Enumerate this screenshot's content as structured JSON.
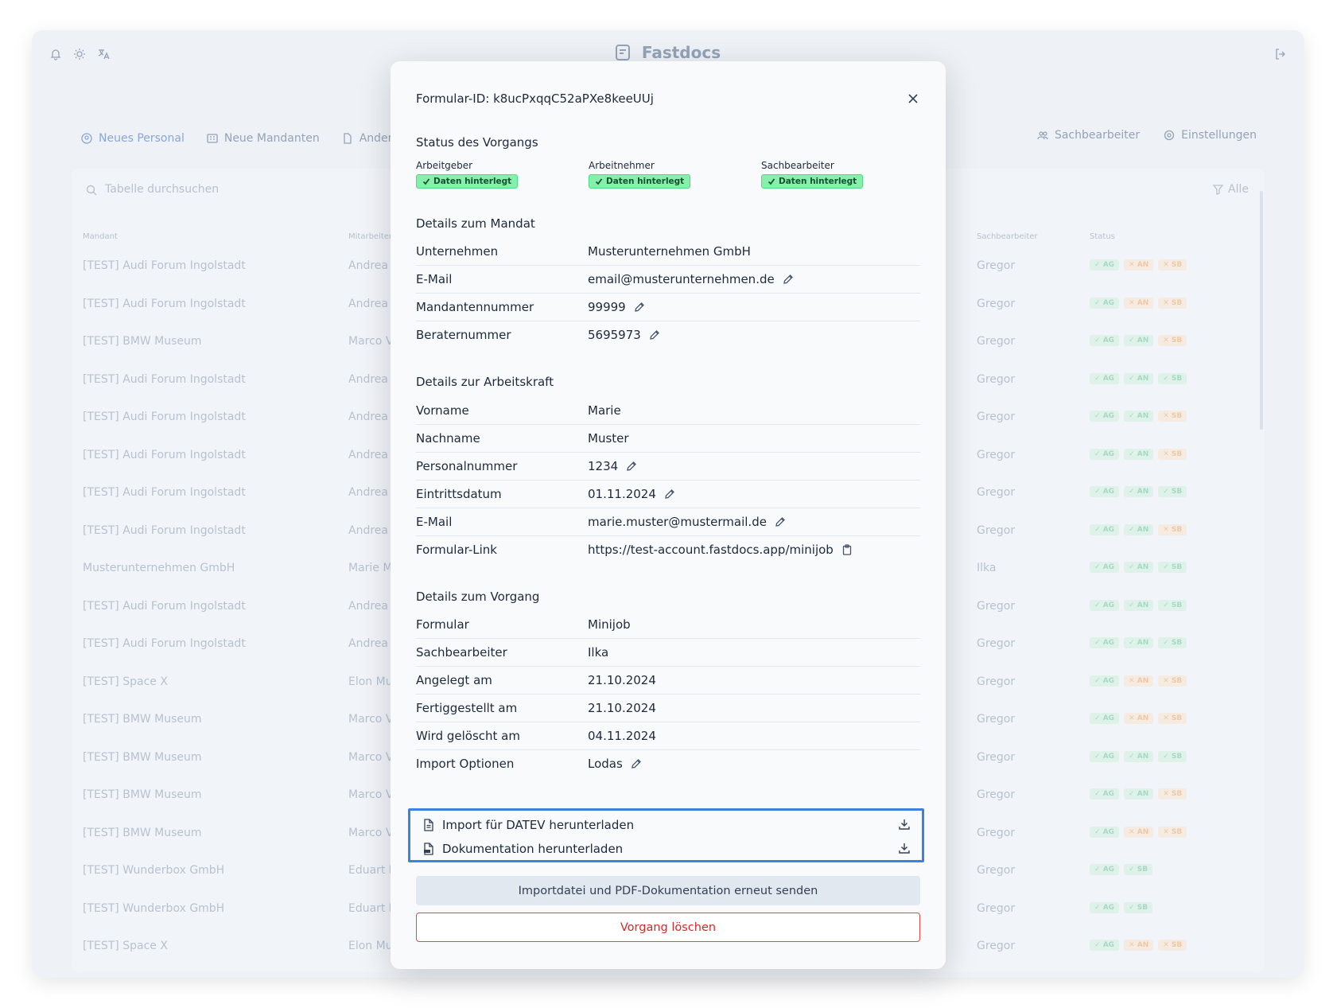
{
  "app": {
    "brand": "Fastdocs",
    "tabs": [
      "Neues Personal",
      "Neue Mandanten",
      "Ander"
    ],
    "tabs_right": [
      "Sachbearbeiter",
      "Einstellungen"
    ],
    "search_placeholder": "Tabelle durchsuchen",
    "filter_label": "Alle",
    "columns": [
      "Mandant",
      "Mitarbeiter",
      "Sachbearbeiter",
      "Status"
    ],
    "rows": [
      {
        "mandant": "[TEST] Audi Forum Ingolstadt",
        "mitarbeiter": "Andrea",
        "sb": "Gregor",
        "status": [
          "ok",
          "no",
          "no"
        ]
      },
      {
        "mandant": "[TEST] Audi Forum Ingolstadt",
        "mitarbeiter": "Andrea",
        "sb": "Gregor",
        "status": [
          "ok",
          "no",
          "no"
        ]
      },
      {
        "mandant": "[TEST] BMW Museum",
        "mitarbeiter": "Marco V",
        "sb": "Gregor",
        "status": [
          "ok",
          "ok",
          "no"
        ]
      },
      {
        "mandant": "[TEST] Audi Forum Ingolstadt",
        "mitarbeiter": "Andrea",
        "sb": "Gregor",
        "status": [
          "ok",
          "ok",
          "ok"
        ]
      },
      {
        "mandant": "[TEST] Audi Forum Ingolstadt",
        "mitarbeiter": "Andrea",
        "sb": "Gregor",
        "status": [
          "ok",
          "ok",
          "no"
        ]
      },
      {
        "mandant": "[TEST] Audi Forum Ingolstadt",
        "mitarbeiter": "Andrea",
        "sb": "Gregor",
        "status": [
          "ok",
          "ok",
          "no"
        ]
      },
      {
        "mandant": "[TEST] Audi Forum Ingolstadt",
        "mitarbeiter": "Andrea",
        "sb": "Gregor",
        "status": [
          "ok",
          "ok",
          "ok"
        ]
      },
      {
        "mandant": "[TEST] Audi Forum Ingolstadt",
        "mitarbeiter": "Andrea",
        "sb": "Gregor",
        "status": [
          "ok",
          "ok",
          "no"
        ]
      },
      {
        "mandant": "Musterunternehmen GmbH",
        "mitarbeiter": "Marie M",
        "sb": "Ilka",
        "status": [
          "ok",
          "ok",
          "ok"
        ]
      },
      {
        "mandant": "[TEST] Audi Forum Ingolstadt",
        "mitarbeiter": "Andrea",
        "sb": "Gregor",
        "status": [
          "ok",
          "ok",
          "ok"
        ]
      },
      {
        "mandant": "[TEST] Audi Forum Ingolstadt",
        "mitarbeiter": "Andrea",
        "sb": "Gregor",
        "status": [
          "ok",
          "ok",
          "ok"
        ]
      },
      {
        "mandant": "[TEST] Space X",
        "mitarbeiter": "Elon Mu",
        "sb": "Gregor",
        "status": [
          "ok",
          "no",
          "no"
        ]
      },
      {
        "mandant": "[TEST] BMW Museum",
        "mitarbeiter": "Marco V",
        "sb": "Gregor",
        "status": [
          "ok",
          "no",
          "no"
        ]
      },
      {
        "mandant": "[TEST] BMW Museum",
        "mitarbeiter": "Marco V",
        "sb": "Gregor",
        "status": [
          "ok",
          "ok",
          "ok"
        ]
      },
      {
        "mandant": "[TEST] BMW Museum",
        "mitarbeiter": "Marco V",
        "sb": "Gregor",
        "status": [
          "ok",
          "ok",
          "no"
        ]
      },
      {
        "mandant": "[TEST] BMW Museum",
        "mitarbeiter": "Marco V",
        "sb": "Gregor",
        "status": [
          "ok",
          "no",
          "no"
        ]
      },
      {
        "mandant": "[TEST] Wunderbox GmbH",
        "mitarbeiter": "Eduart F",
        "sb": "Gregor",
        "status": [
          "ok",
          "ok"
        ]
      },
      {
        "mandant": "[TEST] Wunderbox GmbH",
        "mitarbeiter": "Eduart F",
        "sb": "Gregor",
        "status": [
          "ok",
          "ok"
        ]
      },
      {
        "mandant": "[TEST] Space X",
        "mitarbeiter": "Elon Mu",
        "sb": "Gregor",
        "status": [
          "ok",
          "no",
          "no"
        ]
      }
    ],
    "badge_labels": [
      "AG",
      "AN",
      "SB"
    ],
    "badge_labels_short": [
      "AG",
      "SB"
    ]
  },
  "modal": {
    "title": "Formular-ID: k8ucPxqqC52aPXe8keeUUj",
    "status": {
      "heading": "Status des Vorgangs",
      "items": [
        {
          "label": "Arbeitgeber",
          "value": "Daten hinterlegt"
        },
        {
          "label": "Arbeitnehmer",
          "value": "Daten hinterlegt"
        },
        {
          "label": "Sachbearbeiter",
          "value": "Daten hinterlegt"
        }
      ]
    },
    "mandat": {
      "heading": "Details zum Mandat",
      "rows": [
        {
          "label": "Unternehmen",
          "value": "Musterunternehmen GmbH",
          "icon": ""
        },
        {
          "label": "E-Mail",
          "value": "email@musterunternehmen.de",
          "icon": "pencil-icon"
        },
        {
          "label": "Mandantennummer",
          "value": "99999",
          "icon": "pencil-icon"
        },
        {
          "label": "Beraternummer",
          "value": "5695973",
          "icon": "pencil-icon"
        }
      ]
    },
    "arbeitskraft": {
      "heading": "Details zur Arbeitskraft",
      "rows": [
        {
          "label": "Vorname",
          "value": "Marie",
          "icon": ""
        },
        {
          "label": "Nachname",
          "value": "Muster",
          "icon": ""
        },
        {
          "label": "Personalnummer",
          "value": "1234",
          "icon": "pencil-icon"
        },
        {
          "label": "Eintrittsdatum",
          "value": "01.11.2024",
          "icon": "pencil-icon"
        },
        {
          "label": "E-Mail",
          "value": "marie.muster@mustermail.de",
          "icon": "pencil-icon"
        },
        {
          "label": "Formular-Link",
          "value": "https://test-account.fastdocs.app/minijob",
          "icon": "clipboard-icon"
        }
      ]
    },
    "vorgang": {
      "heading": "Details zum Vorgang",
      "rows": [
        {
          "label": "Formular",
          "value": "Minijob",
          "icon": ""
        },
        {
          "label": "Sachbearbeiter",
          "value": "Ilka",
          "icon": ""
        },
        {
          "label": "Angelegt am",
          "value": "21.10.2024",
          "icon": ""
        },
        {
          "label": "Fertiggestellt am",
          "value": "21.10.2024",
          "icon": ""
        },
        {
          "label": "Wird gelöscht am",
          "value": "04.11.2024",
          "icon": ""
        },
        {
          "label": "Import Optionen",
          "value": "Lodas",
          "icon": "pencil-icon"
        }
      ]
    },
    "downloads": {
      "datev": "Import für DATEV herunterladen",
      "docs": "Dokumentation herunterladen"
    },
    "resend_label": "Importdatei und PDF-Dokumentation erneut senden",
    "delete_label": "Vorgang löschen"
  }
}
